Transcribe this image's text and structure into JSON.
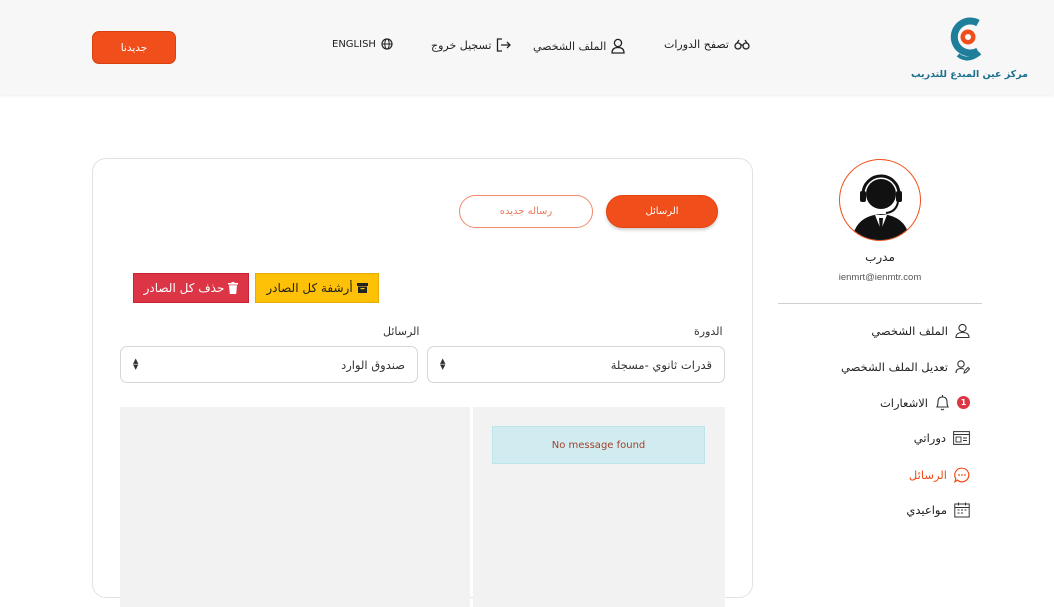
{
  "header": {
    "logo_text": "مركز عين المبدع للتدريب",
    "nav": {
      "browse_courses": "تصفح الدورات",
      "profile": "الملف الشخصي",
      "logout": "تسجيل خروج",
      "language": "ENGLISH"
    },
    "new_button": "جديدنا"
  },
  "messages": {
    "tabs": {
      "inbox": "الرسائل",
      "new_message": "رساله جديده"
    },
    "actions": {
      "archive_all": "أرشفة كل الصادر",
      "delete_all": "حذف كل الصادر"
    },
    "filters": {
      "course_label": "الدورة",
      "course_value": "قدرات ثانوي -مسجلة",
      "messages_label": "الرسائل",
      "messages_value": "صندوق الوارد"
    },
    "empty_text": "No message found"
  },
  "sidebar": {
    "name": "مدرب",
    "email": "ienmrt@ienmtr.com",
    "items": [
      {
        "label": "الملف الشخصي",
        "icon": "user-icon"
      },
      {
        "label": "تعديل الملف الشخصي",
        "icon": "user-edit-icon"
      },
      {
        "label": "الاشعارات",
        "icon": "bell-icon",
        "badge": "1"
      },
      {
        "label": "دوراتي",
        "icon": "courses-icon"
      },
      {
        "label": "الرسائل",
        "icon": "chat-icon",
        "active": true
      },
      {
        "label": "مواعيدي",
        "icon": "calendar-icon"
      }
    ]
  },
  "colors": {
    "accent": "#f04e1a",
    "warning": "#ffc107",
    "danger": "#dc3545",
    "info_bg": "#d1ecf1"
  }
}
